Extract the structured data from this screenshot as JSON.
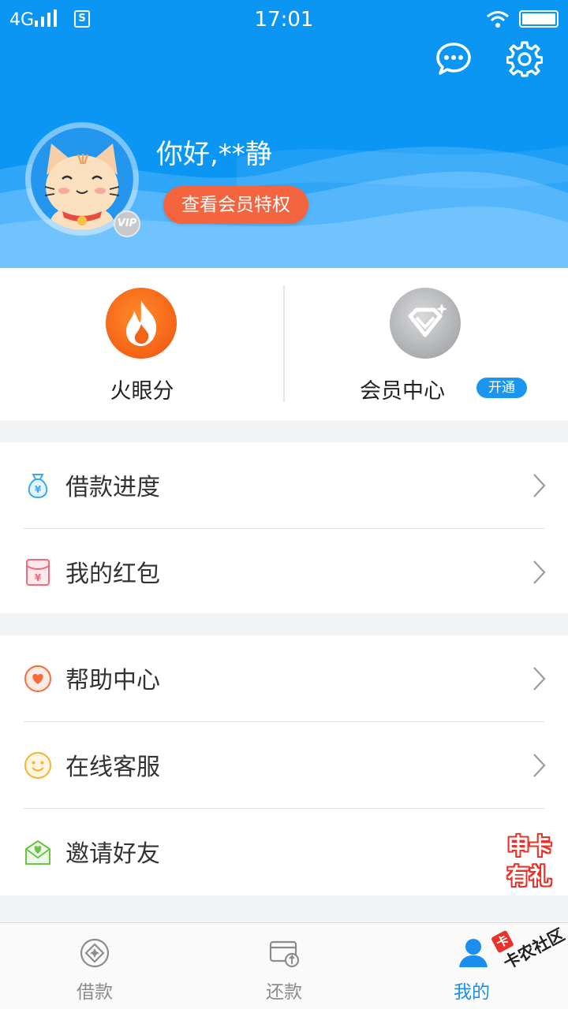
{
  "status_bar": {
    "network": "4G",
    "sim_label": "S",
    "time": "17:01"
  },
  "header": {
    "greeting": "你好,**静",
    "member_button": "查看会员特权",
    "vip_badge": "VIP",
    "background_color": "#0b96f4"
  },
  "features": [
    {
      "label": "火眼分",
      "icon": "fire-icon",
      "color": "#f36318"
    },
    {
      "label": "会员中心",
      "icon": "diamond-icon",
      "color": "#a9abae",
      "badge": "开通"
    }
  ],
  "menu_groups": [
    [
      {
        "label": "借款进度",
        "icon": "money-bag-icon",
        "icon_color": "#3aa7f2"
      },
      {
        "label": "我的红包",
        "icon": "red-envelope-icon",
        "icon_color": "#f06a7a"
      }
    ],
    [
      {
        "label": "帮助中心",
        "icon": "heart-icon",
        "icon_color": "#f46c3c"
      },
      {
        "label": "在线客服",
        "icon": "smiley-icon",
        "icon_color": "#f7b232"
      },
      {
        "label": "邀请好友",
        "icon": "invite-envelope-icon",
        "icon_color": "#6cc24a"
      }
    ]
  ],
  "promo_sticker": {
    "line1": "申卡",
    "line2": "有礼"
  },
  "tabbar": [
    {
      "label": "借款",
      "icon": "loan-diamond-icon",
      "active": false
    },
    {
      "label": "还款",
      "icon": "card-repay-icon",
      "active": false
    },
    {
      "label": "我的",
      "icon": "person-icon",
      "active": true
    }
  ],
  "watermark": {
    "logo": "卡",
    "text": "卡农社区"
  },
  "accent_color": "#1a8ff0"
}
